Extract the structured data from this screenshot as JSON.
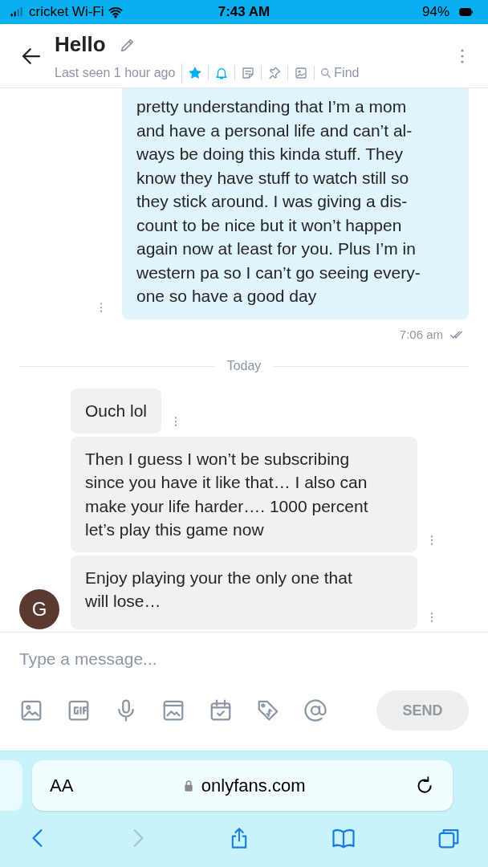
{
  "status_bar": {
    "carrier": "cricket Wi-Fi",
    "time": "7:43 AM",
    "battery": "94%"
  },
  "header": {
    "title": "Hello",
    "last_seen": "Last seen 1 hour ago",
    "find": "Find",
    "favorite": true
  },
  "messages": [
    {
      "kind": "sent",
      "lines": [
        "pretty understanding that I’m a mom",
        "and have a personal life and can’t al-",
        "ways be doing this kinda stuff. They",
        "know they have stuff to watch still so",
        "they stick around. I was giving a dis-",
        "count to be nice but it won’t happen",
        "again now at least for you. Plus I’m in",
        "western pa so I can’t go seeing every-",
        "one so have a good day"
      ],
      "time": "7:06 am",
      "read": true
    },
    {
      "kind": "divider",
      "label": "Today"
    },
    {
      "kind": "received",
      "lines": [
        "Ouch lol"
      ]
    },
    {
      "kind": "received",
      "lines": [
        "Then I guess I won’t be subscribing",
        "since you have it like that… I also can",
        "make your life harder…. 1000 percent",
        "let’s play this game now"
      ]
    },
    {
      "kind": "received",
      "lines": [
        "Enjoy playing your the only one that",
        "will lose…"
      ],
      "avatar": "G"
    }
  ],
  "composer": {
    "placeholder": "Type a message...",
    "send": "SEND"
  },
  "browser": {
    "text_size": "AA",
    "url": "onlyfans.com"
  }
}
